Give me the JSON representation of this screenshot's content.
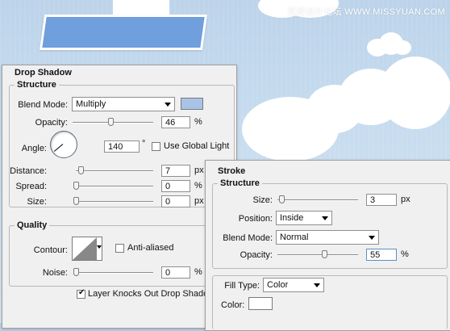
{
  "watermark": "思缘设计论坛 WWW.MISSYUAN.COM",
  "colors": {
    "shadow_swatch": "#a7c4e6",
    "stroke_color": "#ffffff"
  },
  "drop_shadow": {
    "title": "Drop Shadow",
    "structure": {
      "title": "Structure",
      "blend_mode_label": "Blend Mode:",
      "blend_mode_value": "Multiply",
      "opacity_label": "Opacity:",
      "opacity_value": "46",
      "opacity_unit": "%",
      "angle_label": "Angle:",
      "angle_value": "140",
      "angle_unit": "°",
      "global_light_label": "Use Global Light",
      "distance_label": "Distance:",
      "distance_value": "7",
      "distance_unit": "px",
      "spread_label": "Spread:",
      "spread_value": "0",
      "spread_unit": "%",
      "size_label": "Size:",
      "size_value": "0",
      "size_unit": "px"
    },
    "quality": {
      "title": "Quality",
      "contour_label": "Contour:",
      "anti_aliased_label": "Anti-aliased",
      "noise_label": "Noise:",
      "noise_value": "0",
      "noise_unit": "%"
    },
    "knockout_label": "Layer Knocks Out Drop Shadow"
  },
  "stroke": {
    "title": "Stroke",
    "structure": {
      "title": "Structure",
      "size_label": "Size:",
      "size_value": "3",
      "size_unit": "px",
      "position_label": "Position:",
      "position_value": "Inside",
      "blend_mode_label": "Blend Mode:",
      "blend_mode_value": "Normal",
      "opacity_label": "Opacity:",
      "opacity_value": "55",
      "opacity_unit": "%"
    },
    "fill_type_label": "Fill Type:",
    "fill_type_value": "Color",
    "color_label": "Color:"
  }
}
